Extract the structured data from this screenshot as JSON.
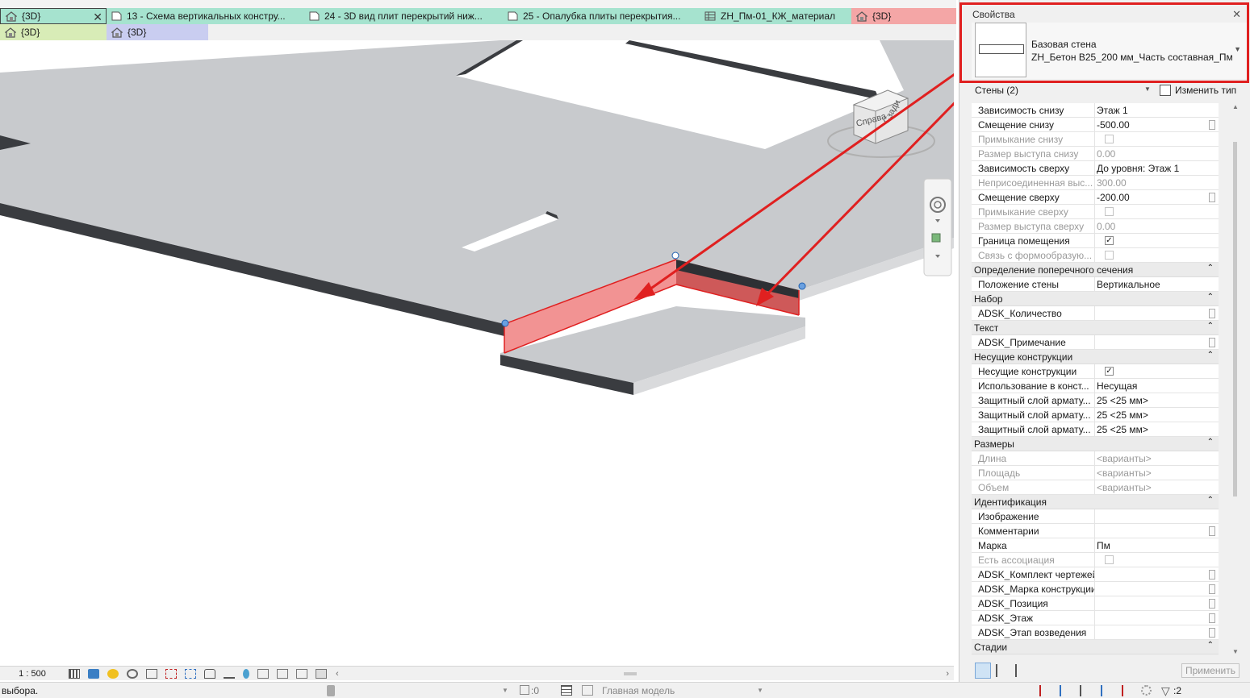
{
  "tabs_row1": [
    {
      "label": "{3D}",
      "active": true,
      "color": "#a6e3cf",
      "icon": "home-3d-icon"
    },
    {
      "label": "13 - Схема вертикальных констру...",
      "color": "#a6e3cf",
      "icon": "sheet-icon"
    },
    {
      "label": "24 - 3D вид плит перекрытий ниж...",
      "color": "#a6e3cf",
      "icon": "sheet-icon"
    },
    {
      "label": "25 - Опалубка плиты перекрытия...",
      "color": "#a6e3cf",
      "icon": "sheet-icon"
    },
    {
      "label": "ZH_Пм-01_КЖ_материал",
      "color": "#a6e3cf",
      "icon": "schedule-icon"
    },
    {
      "label": "{3D}",
      "color": "#f4a6a6",
      "icon": "home-3d-icon"
    }
  ],
  "tabs_row2": [
    {
      "label": "{3D}",
      "color": "#d8ecb7",
      "icon": "home-3d-icon"
    },
    {
      "label": "{3D}",
      "color": "#c9cdf0",
      "icon": "home-3d-icon"
    }
  ],
  "viewcube": {
    "face_right": "Справа",
    "face_back": "Сзади"
  },
  "properties": {
    "title": "Свойства",
    "close": "✕",
    "type_family": "Базовая стена",
    "type_name": "ZH_Бетон B25_200 мм_Часть составная_Пм",
    "selector": "Стены (2)",
    "edit_type": "Изменить тип",
    "apply": "Применить",
    "rows": [
      {
        "kind": "row",
        "name": "Зависимость снизу",
        "value": "Этаж 1"
      },
      {
        "kind": "row",
        "name": "Смещение снизу",
        "value": "-500.00",
        "button": true
      },
      {
        "kind": "check",
        "name": "Примыкание снизу",
        "checked": false,
        "disabled": true
      },
      {
        "kind": "row",
        "name": "Размер выступа снизу",
        "value": "0.00",
        "disabled": true
      },
      {
        "kind": "row",
        "name": "Зависимость сверху",
        "value": "До уровня: Этаж 1"
      },
      {
        "kind": "row",
        "name": "Неприсоединенная выс...",
        "value": "300.00",
        "disabled": true
      },
      {
        "kind": "row",
        "name": "Смещение сверху",
        "value": "-200.00",
        "button": true
      },
      {
        "kind": "check",
        "name": "Примыкание сверху",
        "checked": false,
        "disabled": true
      },
      {
        "kind": "row",
        "name": "Размер выступа сверху",
        "value": "0.00",
        "disabled": true
      },
      {
        "kind": "check",
        "name": "Граница помещения",
        "checked": true
      },
      {
        "kind": "check",
        "name": "Связь с формообразую...",
        "checked": false,
        "disabled": true
      },
      {
        "kind": "group",
        "name": "Определение поперечного сечения"
      },
      {
        "kind": "row",
        "name": "Положение стены",
        "value": "Вертикальное"
      },
      {
        "kind": "group",
        "name": "Набор"
      },
      {
        "kind": "row",
        "name": "ADSK_Количество",
        "value": "",
        "button": true
      },
      {
        "kind": "group",
        "name": "Текст"
      },
      {
        "kind": "row",
        "name": "ADSK_Примечание",
        "value": "",
        "button": true
      },
      {
        "kind": "group",
        "name": "Несущие конструкции"
      },
      {
        "kind": "check",
        "name": "Несущие конструкции",
        "checked": true
      },
      {
        "kind": "row",
        "name": "Использование в конст...",
        "value": "Несущая"
      },
      {
        "kind": "row",
        "name": "Защитный слой армату...",
        "value": "25 <25 мм>"
      },
      {
        "kind": "row",
        "name": "Защитный слой армату...",
        "value": "25 <25 мм>"
      },
      {
        "kind": "row",
        "name": "Защитный слой армату...",
        "value": "25 <25 мм>"
      },
      {
        "kind": "group",
        "name": "Размеры"
      },
      {
        "kind": "row",
        "name": "Длина",
        "value": "<варианты>",
        "disabled": true
      },
      {
        "kind": "row",
        "name": "Площадь",
        "value": "<варианты>",
        "disabled": true
      },
      {
        "kind": "row",
        "name": "Объем",
        "value": "<варианты>",
        "disabled": true
      },
      {
        "kind": "group",
        "name": "Идентификация"
      },
      {
        "kind": "row",
        "name": "Изображение",
        "value": ""
      },
      {
        "kind": "row",
        "name": "Комментарии",
        "value": "",
        "button": true
      },
      {
        "kind": "row",
        "name": "Марка",
        "value": "Пм"
      },
      {
        "kind": "check",
        "name": "Есть ассоциация",
        "checked": false,
        "disabled": true
      },
      {
        "kind": "row",
        "name": "ADSK_Комплект чертежей",
        "value": "",
        "button": true
      },
      {
        "kind": "row",
        "name": "ADSK_Марка конструкции",
        "value": "",
        "button": true
      },
      {
        "kind": "row",
        "name": "ADSK_Позиция",
        "value": "",
        "button": true
      },
      {
        "kind": "row",
        "name": "ADSK_Этаж",
        "value": "",
        "button": true
      },
      {
        "kind": "row",
        "name": "ADSK_Этап возведения",
        "value": "",
        "button": true
      },
      {
        "kind": "group",
        "name": "Стадии"
      }
    ]
  },
  "view_bar": {
    "scale": "1 : 500"
  },
  "status": {
    "message": "выбора.",
    "count_a": ":0",
    "model": "Главная модель",
    "filter_count": ":2"
  },
  "colors": {
    "annotation": "#e02020",
    "highlight": "#f08080",
    "slab_top": "#c8cacd",
    "slab_edge": "#3a3c40"
  }
}
